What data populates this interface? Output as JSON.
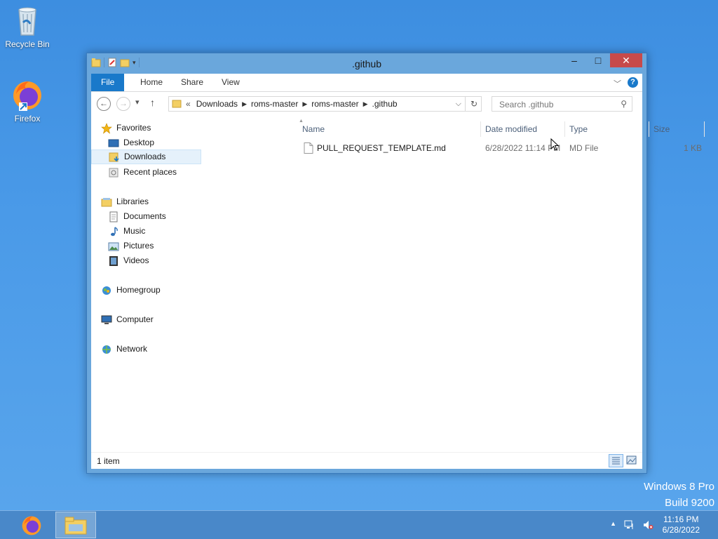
{
  "desktop": {
    "icons": [
      {
        "label": "Recycle Bin",
        "icon": "recycle-bin-icon"
      },
      {
        "label": "Firefox",
        "icon": "firefox-icon"
      }
    ]
  },
  "window": {
    "title": ".github",
    "qat_icons": [
      "folder-icon",
      "properties-icon",
      "new-folder-icon",
      "dropdown-icon"
    ],
    "controls": {
      "minimize": "–",
      "maximize": "□",
      "close": "✕"
    }
  },
  "ribbon": {
    "tabs": [
      "File",
      "Home",
      "Share",
      "View"
    ],
    "help": "?"
  },
  "navbar": {
    "back": "←",
    "forward": "→",
    "recent": "▾",
    "up": "↑",
    "overflow": "«",
    "breadcrumbs": [
      "Downloads",
      "roms-master",
      "roms-master",
      ".github"
    ],
    "search_placeholder": "Search .github"
  },
  "navpane": {
    "items": [
      {
        "label": "Favorites",
        "icon": "star-icon"
      },
      {
        "label": "Desktop",
        "icon": "desktop-icon"
      },
      {
        "label": "Downloads",
        "icon": "downloads-icon",
        "selected": true
      },
      {
        "label": "Recent places",
        "icon": "recent-places-icon"
      },
      {
        "label": "Libraries",
        "icon": "libraries-icon"
      },
      {
        "label": "Documents",
        "icon": "documents-icon"
      },
      {
        "label": "Music",
        "icon": "music-icon"
      },
      {
        "label": "Pictures",
        "icon": "pictures-icon"
      },
      {
        "label": "Videos",
        "icon": "videos-icon"
      },
      {
        "label": "Homegroup",
        "icon": "homegroup-icon"
      },
      {
        "label": "Computer",
        "icon": "computer-icon"
      },
      {
        "label": "Network",
        "icon": "network-icon"
      }
    ]
  },
  "files": {
    "columns": [
      "Name",
      "Date modified",
      "Type",
      "Size"
    ],
    "rows": [
      {
        "name": "PULL_REQUEST_TEMPLATE.md",
        "date": "6/28/2022 11:14 PM",
        "type": "MD File",
        "size": "1 KB"
      }
    ]
  },
  "statusbar": {
    "count": "1 item"
  },
  "watermark": {
    "line1": "Windows 8 Pro",
    "line2": "Build 9200"
  },
  "taskbar": {
    "time": "11:16 PM",
    "date": "6/28/2022"
  },
  "colors": {
    "accent": "#1979ca",
    "close": "#c74a4a",
    "desktop": "#4a9ae8"
  }
}
